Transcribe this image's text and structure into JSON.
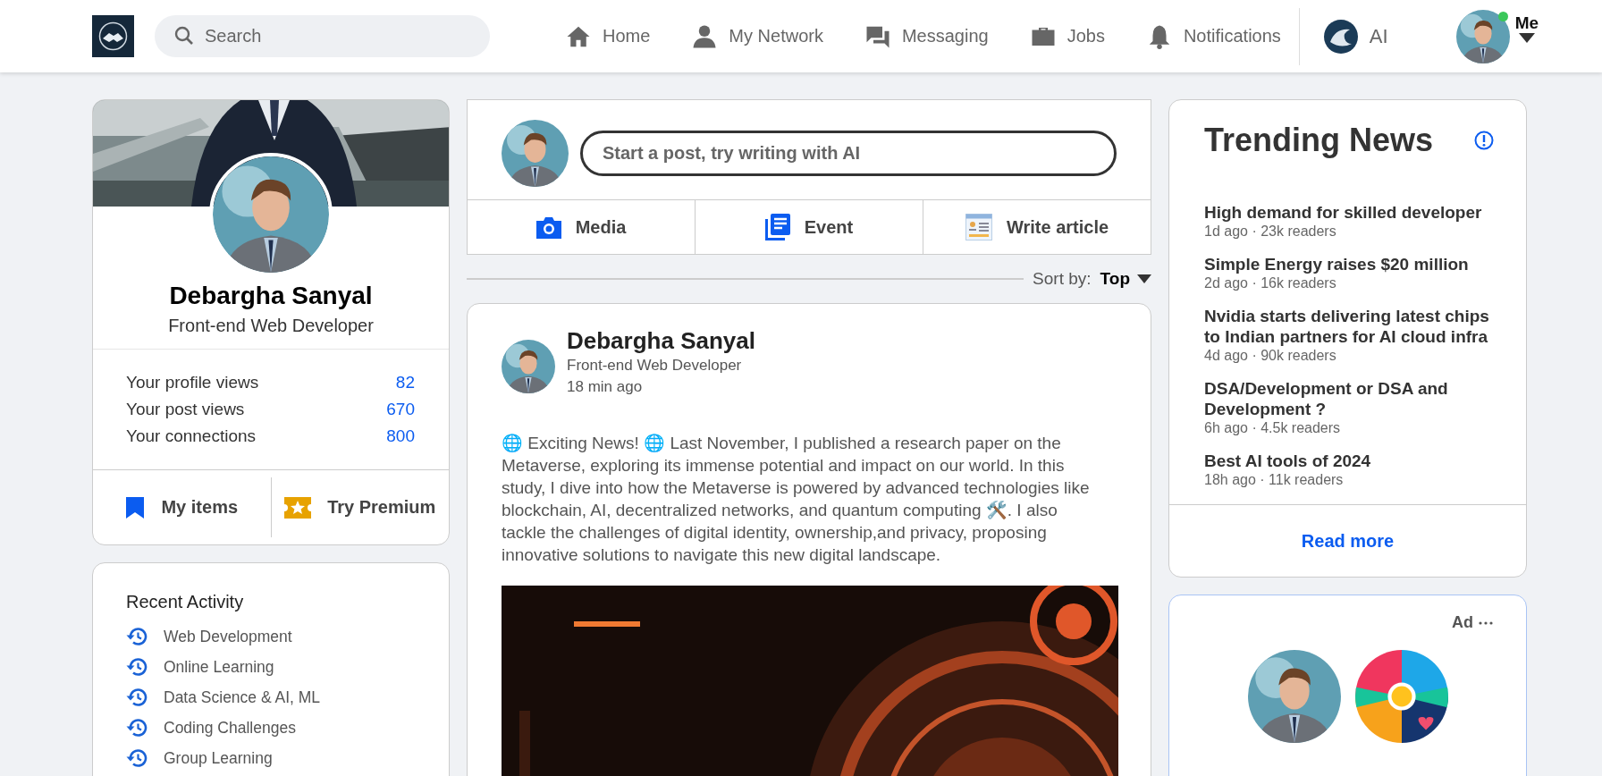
{
  "header": {
    "search": {
      "placeholder": "Search"
    },
    "nav": [
      "Home",
      "My Network",
      "Messaging",
      "Jobs",
      "Notifications"
    ],
    "ai": {
      "label": "AI"
    },
    "me": {
      "label": "Me",
      "online": true
    }
  },
  "profile": {
    "name": "Debargha Sanyal",
    "title": "Front-end Web Developer",
    "stats": [
      {
        "label": "Your profile views",
        "value": "82"
      },
      {
        "label": "Your post views",
        "value": "670"
      },
      {
        "label": "Your connections",
        "value": "800"
      }
    ],
    "actions": [
      "My items",
      "Try Premium"
    ]
  },
  "recent_activity": {
    "title": "Recent Activity",
    "items": [
      "Web Development",
      "Online Learning",
      "Data Science & AI, ML",
      "Coding Challenges",
      "Group Learning"
    ]
  },
  "composer": {
    "placeholder": "Start a post, try writing with AI",
    "actions": [
      "Media",
      "Event",
      "Write article"
    ]
  },
  "sort": {
    "label": "Sort by:",
    "value": "Top"
  },
  "post": {
    "author": "Debargha Sanyal",
    "title": "Front-end Web Developer",
    "time": "18 min ago",
    "body": "🌐 Exciting News! 🌐 Last November, I published a research paper on the Metaverse, exploring its immense potential and impact on our world. In this study, I dive into how the Metaverse is powered by advanced technologies like blockchain, AI, decentralized networks, and quantum computing 🛠️. I also tackle the challenges of digital identity, ownership,and privacy, proposing innovative solutions to navigate this new digital landscape."
  },
  "trending": {
    "title": "Trending News",
    "items": [
      {
        "headline": "High demand for skilled developer",
        "meta": "1d ago · 23k readers"
      },
      {
        "headline": "Simple Energy raises $20 million",
        "meta": "2d ago · 16k readers"
      },
      {
        "headline": "Nvidia starts delivering latest chips to Indian partners for AI cloud infra",
        "meta": "4d ago · 90k readers"
      },
      {
        "headline": "DSA/Development or DSA and Development ?",
        "meta": "6h ago · 4.5k readers"
      },
      {
        "headline": "Best AI tools of 2024",
        "meta": "18h ago · 11k readers"
      }
    ],
    "link": "Read more"
  },
  "ad": {
    "label": "Ad"
  }
}
